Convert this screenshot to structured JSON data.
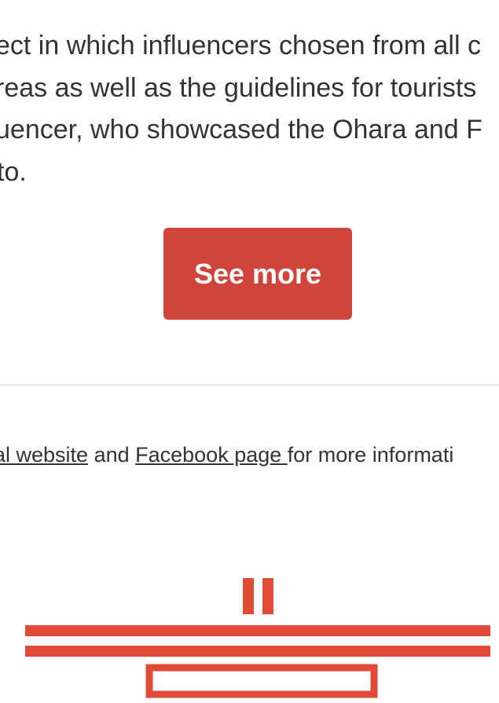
{
  "article": {
    "lines": [
      "ect in which influencers chosen from all c",
      "reas as well as the guidelines for tourists",
      "uencer, who showcased the Ohara and F",
      "to."
    ]
  },
  "see_more_button": {
    "label": "See more",
    "color": "#d0453b"
  },
  "footer": {
    "link1": "ial website",
    "text1": " and ",
    "link2": "Facebook page ",
    "text2": "for more informati"
  },
  "logo": {
    "icon": "red-striped-logo-icon",
    "color": "#e04a37"
  }
}
